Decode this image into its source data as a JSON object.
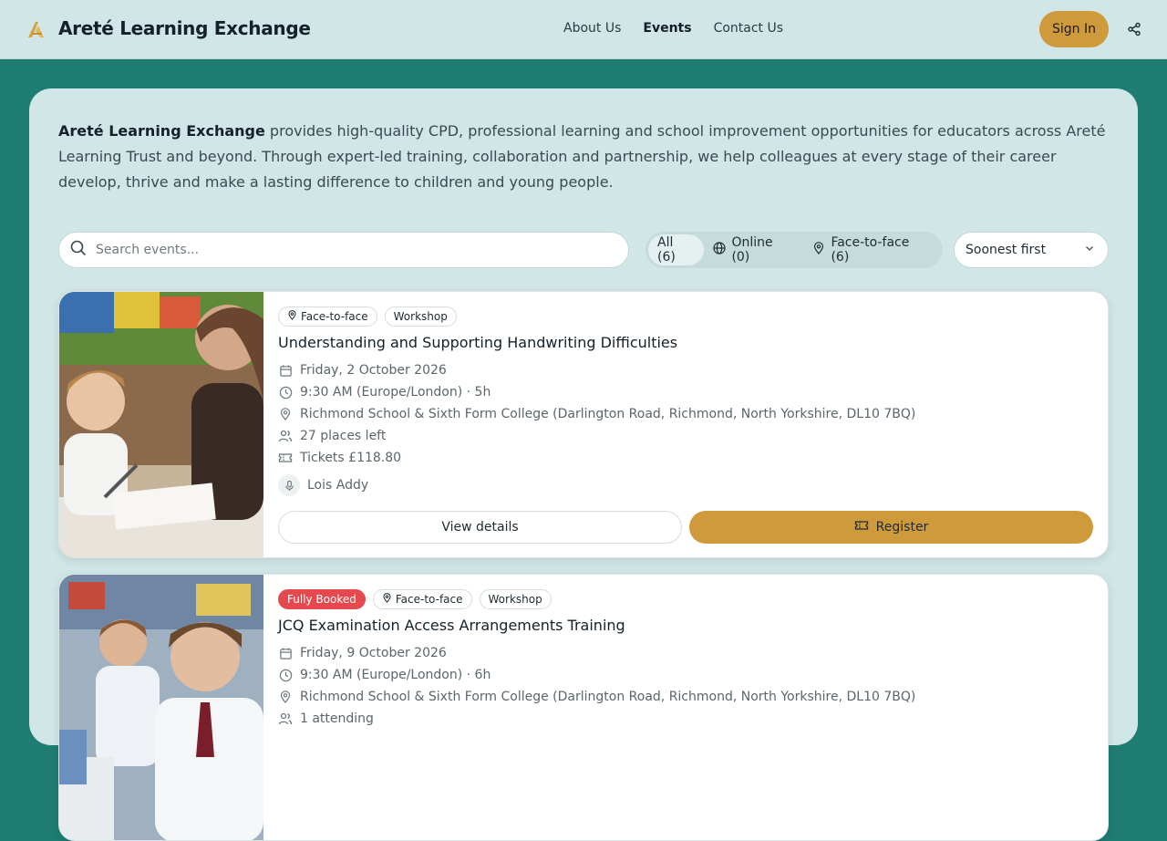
{
  "header": {
    "brand": "Areté Learning Exchange",
    "nav": [
      "About Us",
      "Events",
      "Contact Us"
    ],
    "active_nav": "Events",
    "sign_in": "Sign In",
    "accent": "#cf9a3b"
  },
  "intro": {
    "strong": "Areté Learning Exchange",
    "text": " provides high-quality CPD, professional learning and school improvement opportunities for educators across Areté Learning Trust and beyond. Through expert-led training, collaboration and partnership, we help colleagues at every stage of their career develop, thrive and make a lasting difference to children and young people."
  },
  "toolbar": {
    "search_placeholder": "Search events...",
    "filters": [
      {
        "label": "All (6)",
        "icon": "none",
        "active": true
      },
      {
        "label": "Online (0)",
        "icon": "globe-icon",
        "active": false
      },
      {
        "label": "Face-to-face (6)",
        "icon": "map-pin-icon",
        "active": false
      }
    ],
    "sort": "Soonest first"
  },
  "events": [
    {
      "tags": [
        "Face-to-face",
        "Workshop"
      ],
      "title": "Understanding and Supporting Handwriting Difficulties",
      "date": "Friday, 2 October 2026",
      "time": "9:30 AM (Europe/London) · 5h",
      "location": "Richmond School & Sixth Form College (Darlington Road, Richmond, North Yorkshire, DL10 7BQ)",
      "places": "27 places left",
      "tickets": "Tickets £118.80",
      "speaker": "Lois Addy",
      "view_label": "View details",
      "register_label": "Register"
    },
    {
      "status": "Fully Booked",
      "tags": [
        "Face-to-face",
        "Workshop"
      ],
      "title": "JCQ Examination Access Arrangements Training",
      "date": "Friday, 9 October 2026",
      "time": "9:30 AM (Europe/London) · 6h",
      "location": "Richmond School & Sixth Form College (Darlington Road, Richmond, North Yorkshire, DL10 7BQ)",
      "places": "1 attending"
    }
  ]
}
